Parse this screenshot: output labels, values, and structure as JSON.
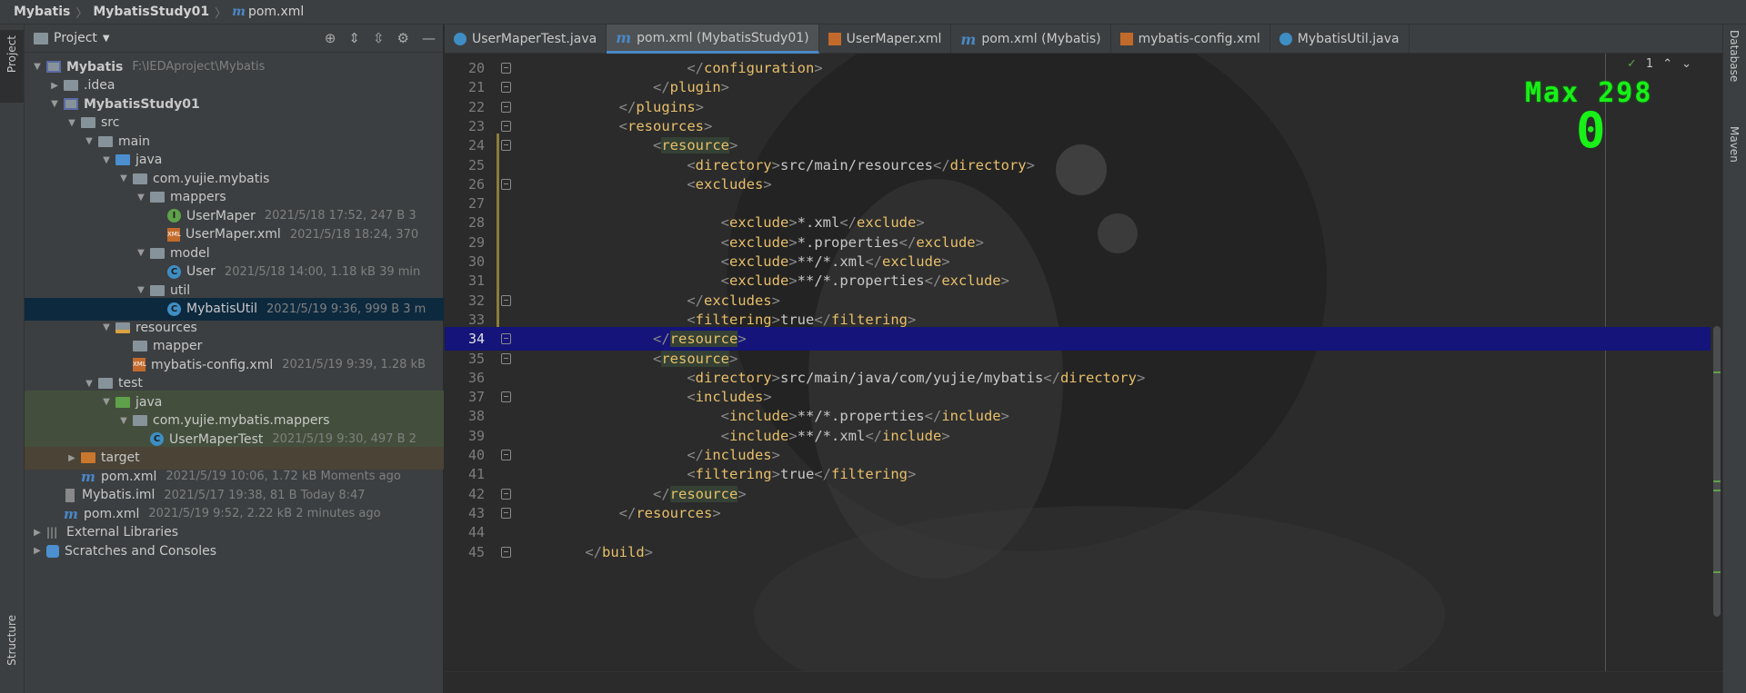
{
  "breadcrumb": [
    "Mybatis",
    "MybatisStudy01",
    "pom.xml"
  ],
  "left_stripe": {
    "project_tab": "Project",
    "structure_tab": "Structure"
  },
  "right_stripe": {
    "database_tab": "Database",
    "maven_tab": "Maven"
  },
  "project_panel": {
    "title": "Project",
    "tree": [
      {
        "label": "Mybatis",
        "meta": "F:\\IEDAproject\\Mybatis"
      },
      {
        "label": ".idea",
        "meta": ""
      },
      {
        "label": "MybatisStudy01",
        "meta": ""
      },
      {
        "label": "src",
        "meta": ""
      },
      {
        "label": "main",
        "meta": ""
      },
      {
        "label": "java",
        "meta": ""
      },
      {
        "label": "com.yujie.mybatis",
        "meta": ""
      },
      {
        "label": "mappers",
        "meta": ""
      },
      {
        "label": "UserMaper",
        "meta": "2021/5/18 17:52, 247 B 3"
      },
      {
        "label": "UserMaper.xml",
        "meta": "2021/5/18 18:24, 370"
      },
      {
        "label": "model",
        "meta": ""
      },
      {
        "label": "User",
        "meta": "2021/5/18 14:00, 1.18 kB 39 min"
      },
      {
        "label": "util",
        "meta": ""
      },
      {
        "label": "MybatisUtil",
        "meta": "2021/5/19 9:36, 999 B 3 m"
      },
      {
        "label": "resources",
        "meta": ""
      },
      {
        "label": "mapper",
        "meta": ""
      },
      {
        "label": "mybatis-config.xml",
        "meta": "2021/5/19 9:39, 1.28 kB"
      },
      {
        "label": "test",
        "meta": ""
      },
      {
        "label": "java",
        "meta": ""
      },
      {
        "label": "com.yujie.mybatis.mappers",
        "meta": ""
      },
      {
        "label": "UserMaperTest",
        "meta": "2021/5/19 9:30, 497 B 2"
      },
      {
        "label": "target",
        "meta": ""
      },
      {
        "label": "pom.xml",
        "meta": "2021/5/19 10:06, 1.72 kB Moments ago"
      },
      {
        "label": "Mybatis.iml",
        "meta": "2021/5/17 19:38, 81 B Today 8:47"
      },
      {
        "label": "pom.xml",
        "meta": "2021/5/19 9:52, 2.22 kB 2 minutes ago"
      },
      {
        "label": "External Libraries",
        "meta": ""
      },
      {
        "label": "Scratches and Consoles",
        "meta": ""
      }
    ]
  },
  "editor_tabs": [
    {
      "label": "UserMaperTest.java",
      "icon": "class-icon"
    },
    {
      "label": "pom.xml (MybatisStudy01)",
      "icon": "maven-icon",
      "active": true
    },
    {
      "label": "UserMaper.xml",
      "icon": "xml-icon"
    },
    {
      "label": "pom.xml (Mybatis)",
      "icon": "maven-icon"
    },
    {
      "label": "mybatis-config.xml",
      "icon": "xml-icon"
    },
    {
      "label": "MybatisUtil.java",
      "icon": "class-icon"
    }
  ],
  "inspection": {
    "count": "1"
  },
  "overlay": {
    "max_label": "Max 298",
    "counter": "0"
  },
  "code_lines": [
    {
      "n": "20",
      "t": "                </configuration>"
    },
    {
      "n": "21",
      "t": "            </plugin>"
    },
    {
      "n": "22",
      "t": "        </plugins>"
    },
    {
      "n": "23",
      "t": "        <resources>"
    },
    {
      "n": "24",
      "t": "            <resource>"
    },
    {
      "n": "25",
      "t": "                <directory>src/main/resources</directory>"
    },
    {
      "n": "26",
      "t": "                <excludes>"
    },
    {
      "n": "27",
      "t": ""
    },
    {
      "n": "28",
      "t": "                    <exclude>*.xml</exclude>"
    },
    {
      "n": "29",
      "t": "                    <exclude>*.properties</exclude>"
    },
    {
      "n": "30",
      "t": "                    <exclude>**/*.xml</exclude>"
    },
    {
      "n": "31",
      "t": "                    <exclude>**/*.properties</exclude>"
    },
    {
      "n": "32",
      "t": "                </excludes>"
    },
    {
      "n": "33",
      "t": "                <filtering>true</filtering>"
    },
    {
      "n": "34",
      "t": "            </resource>"
    },
    {
      "n": "35",
      "t": "            <resource>"
    },
    {
      "n": "36",
      "t": "                <directory>src/main/java/com/yujie/mybatis</directory>"
    },
    {
      "n": "37",
      "t": "                <includes>"
    },
    {
      "n": "38",
      "t": "                    <include>**/*.properties</include>"
    },
    {
      "n": "39",
      "t": "                    <include>**/*.xml</include>"
    },
    {
      "n": "40",
      "t": "                </includes>"
    },
    {
      "n": "41",
      "t": "                <filtering>true</filtering>"
    },
    {
      "n": "42",
      "t": "            </resource>"
    },
    {
      "n": "43",
      "t": "        </resources>"
    },
    {
      "n": "44",
      "t": ""
    },
    {
      "n": "45",
      "t": "    </build>"
    }
  ],
  "colors": {
    "accent": "#4a88c7",
    "selection_line": "#14147a",
    "overlay_green": "#18f018"
  }
}
